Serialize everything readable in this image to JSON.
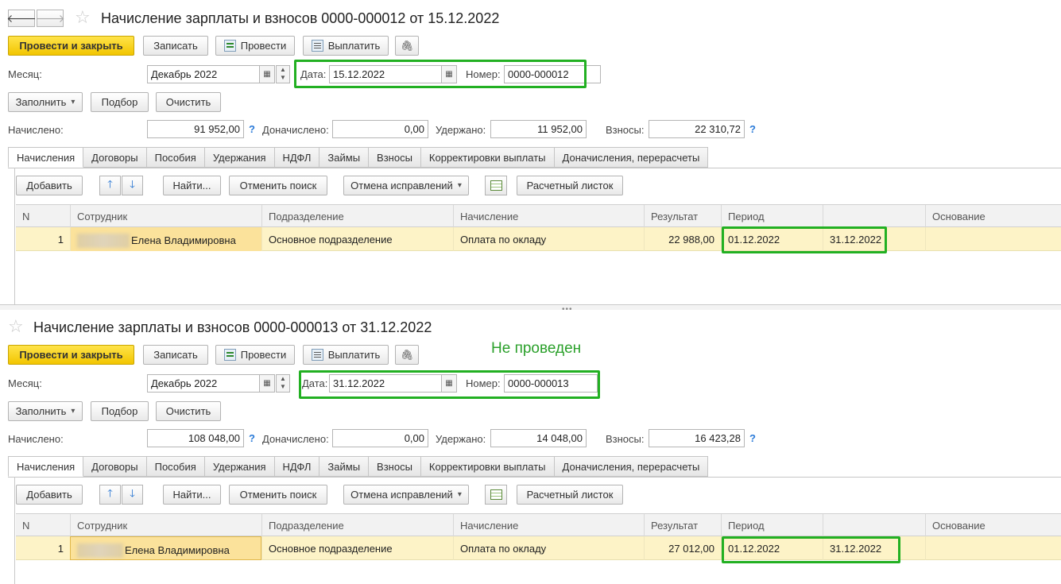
{
  "accent": "#f2c500",
  "highlight_color": "#22b022",
  "docs": [
    {
      "title": "Начисление зарплаты и взносов 0000-000012 от 15.12.2022",
      "toolbar": {
        "post_close": "Провести и закрыть",
        "save": "Записать",
        "post": "Провести",
        "pay": "Выплатить"
      },
      "month_label": "Месяц:",
      "month_value": "Декабрь 2022",
      "date_label": "Дата:",
      "date_value": "15.12.2022",
      "number_label": "Номер:",
      "number_value": "0000-000012",
      "fill_btn": "Заполнить",
      "select_btn": "Подбор",
      "clear_btn": "Очистить",
      "accrued_label": "Начислено:",
      "accrued_value": "91 952,00",
      "extra_label": "Доначислено:",
      "extra_value": "0,00",
      "withheld_label": "Удержано:",
      "withheld_value": "11 952,00",
      "contrib_label": "Взносы:",
      "contrib_value": "22 310,72",
      "tabs": [
        "Начисления",
        "Договоры",
        "Пособия",
        "Удержания",
        "НДФЛ",
        "Займы",
        "Взносы",
        "Корректировки выплаты",
        "Доначисления, перерасчеты"
      ],
      "table_toolbar": {
        "add": "Добавить",
        "find": "Найти...",
        "cancel_search": "Отменить поиск",
        "cancel_fix": "Отмена исправлений",
        "payslip": "Расчетный листок"
      },
      "columns": [
        "N",
        "Сотрудник",
        "Подразделение",
        "Начисление",
        "Результат",
        "Период",
        "",
        "Основание"
      ],
      "rows": [
        {
          "n": "1",
          "employee": "Елена Владимировна",
          "dept": "Основное подразделение",
          "accrual": "Оплата по окладу",
          "result": "22 988,00",
          "from": "01.12.2022",
          "to": "31.12.2022",
          "basis": ""
        }
      ]
    },
    {
      "title": "Начисление зарплаты и взносов 0000-000013 от 31.12.2022",
      "toolbar": {
        "post_close": "Провести и закрыть",
        "save": "Записать",
        "post": "Провести",
        "pay": "Выплатить"
      },
      "status_note": "Не проведен",
      "month_label": "Месяц:",
      "month_value": "Декабрь 2022",
      "date_label": "Дата:",
      "date_value": "31.12.2022",
      "number_label": "Номер:",
      "number_value": "0000-000013",
      "fill_btn": "Заполнить",
      "select_btn": "Подбор",
      "clear_btn": "Очистить",
      "accrued_label": "Начислено:",
      "accrued_value": "108 048,00",
      "extra_label": "Доначислено:",
      "extra_value": "0,00",
      "withheld_label": "Удержано:",
      "withheld_value": "14 048,00",
      "contrib_label": "Взносы:",
      "contrib_value": "16 423,28",
      "tabs": [
        "Начисления",
        "Договоры",
        "Пособия",
        "Удержания",
        "НДФЛ",
        "Займы",
        "Взносы",
        "Корректировки выплаты",
        "Доначисления, перерасчеты"
      ],
      "table_toolbar": {
        "add": "Добавить",
        "find": "Найти...",
        "cancel_search": "Отменить поиск",
        "cancel_fix": "Отмена исправлений",
        "payslip": "Расчетный листок"
      },
      "columns": [
        "N",
        "Сотрудник",
        "Подразделение",
        "Начисление",
        "Результат",
        "Период",
        "",
        "Основание"
      ],
      "rows": [
        {
          "n": "1",
          "employee": "Елена Владимировна",
          "dept": "Основное подразделение",
          "accrual": "Оплата по окладу",
          "result": "27 012,00",
          "from": "01.12.2022",
          "to": "31.12.2022",
          "basis": ""
        }
      ]
    }
  ]
}
